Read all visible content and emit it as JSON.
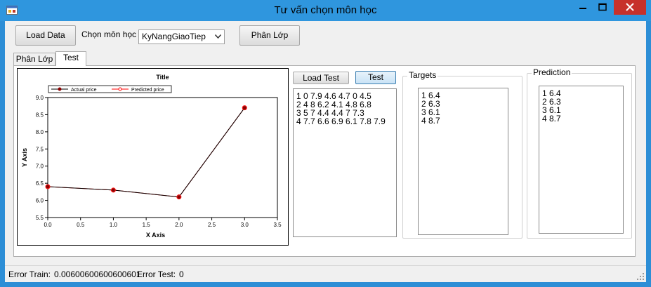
{
  "window": {
    "title": "Tư vấn chọn môn học"
  },
  "toolbar": {
    "load_data_label": "Load Data",
    "subject_label": "Chọn môn học",
    "subject_selected": "KyNangGiaoTiep",
    "classify_label": "Phân Lớp"
  },
  "tabs": [
    {
      "label": "Phân Lớp",
      "selected": false
    },
    {
      "label": "Test",
      "selected": true
    }
  ],
  "test_panel": {
    "load_test_label": "Load Test",
    "test_label": "Test",
    "data_lines": [
      "1 0 7.9 4.6 4.7 0 4.5",
      "2 4 8 6.2 4.1 4.8 6.8",
      "3 5 7 4.4 4.4 7 7.3",
      "4 7.7 6.6 6.9 6.1 7.8 7.9"
    ],
    "targets_title": "Targets",
    "targets_lines": [
      "1 6.4",
      "2 6.3",
      "3 6.1",
      "4 8.7"
    ],
    "prediction_title": "Prediction",
    "prediction_lines": [
      "1 6.4",
      "2 6.3",
      "3 6.1",
      "4 8.7"
    ]
  },
  "status": {
    "error_train_label": "Error Train:",
    "error_train_value": "0.00600600600600601",
    "error_test_label": "Error Test:",
    "error_test_value": "0"
  },
  "colors": {
    "titlebar": "#2f96de",
    "close_button": "#c7312b",
    "actual_series": "#8b0000",
    "predicted_series": "#ff0000"
  },
  "chart_data": {
    "type": "line",
    "title": "Title",
    "xlabel": "X Axis",
    "ylabel": "Y Axis",
    "xlim": [
      0.0,
      3.5
    ],
    "ylim": [
      5.5,
      9.0
    ],
    "xticks": [
      "0.0",
      "0.5",
      "1.0",
      "1.5",
      "2.0",
      "2.5",
      "3.0",
      "3.5"
    ],
    "yticks": [
      "5.5",
      "6.0",
      "6.5",
      "7.0",
      "7.5",
      "8.0",
      "8.5",
      "9.0"
    ],
    "grid": false,
    "legend_position": "top",
    "series": [
      {
        "name": "Actual price",
        "x": [
          0,
          1,
          2,
          3
        ],
        "y": [
          6.4,
          6.3,
          6.1,
          8.7
        ],
        "marker": "filled-circle"
      },
      {
        "name": "Predicted price",
        "x": [
          0,
          1,
          2,
          3
        ],
        "y": [
          6.4,
          6.3,
          6.1,
          8.7
        ],
        "marker": "open-circle"
      }
    ]
  }
}
